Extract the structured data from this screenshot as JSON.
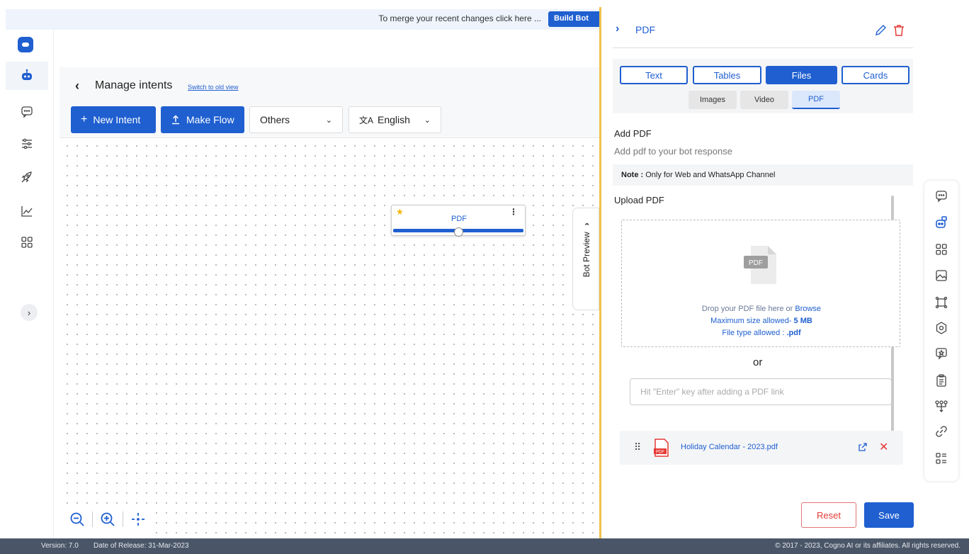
{
  "merge_bar": {
    "message": "To merge your recent changes click here ...",
    "build_button": "Build Bot"
  },
  "header": {
    "title": "Manage intents",
    "old_view_link": "Switch to old view",
    "new_intent_label": "New Intent",
    "make_flow_label": "Make Flow",
    "category_select": "Others",
    "language_select": "English"
  },
  "canvas": {
    "node_title": "PDF",
    "bot_preview_label": "Bot Preview"
  },
  "panel": {
    "title": "PDF",
    "type_tabs": [
      "Text",
      "Tables",
      "Files",
      "Cards"
    ],
    "active_type_tab": "Files",
    "sub_tabs": [
      "Images",
      "Video",
      "PDF"
    ],
    "active_sub_tab": "PDF",
    "add_title": "Add PDF",
    "add_subtitle": "Add pdf to your bot response",
    "note_label": "Note :",
    "note_text": "Only for Web and WhatsApp Channel",
    "upload_title": "Upload PDF",
    "file_icon_label": "PDF",
    "drop_text": "Drop your PDF file here or",
    "browse_link": "Browse",
    "max_size_label": "Maximum size allowed-",
    "max_size_value": "5 MB",
    "file_type_label": "File type allowed :",
    "file_type_value": ".pdf",
    "or_text": "or",
    "link_placeholder": "Hit \"Enter\" key after adding a PDF link",
    "uploaded_file": "Holiday Calendar - 2023.pdf",
    "pdf_badge": "PDF",
    "reset_label": "Reset",
    "save_label": "Save"
  },
  "footer": {
    "version": "Version: 7.0",
    "release": "Date of Release: 31-Mar-2023",
    "copyright": "© 2017 - 2023, Cogno AI or its affiliates. All rights reserved."
  },
  "colors": {
    "primary": "#1f5fd0",
    "danger": "#e53935",
    "panel_border": "#f0c24b",
    "footer_bg": "#4a5668"
  }
}
